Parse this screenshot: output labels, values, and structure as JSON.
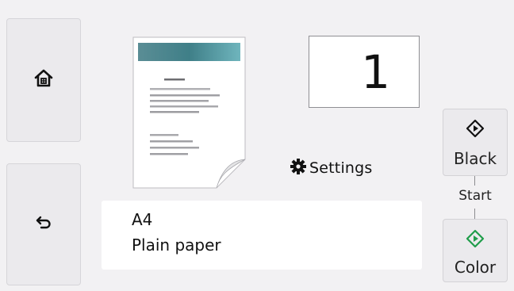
{
  "nav": {
    "home_icon": "home-icon",
    "back_icon": "back-arrow-icon"
  },
  "copies": {
    "value": "1"
  },
  "settings": {
    "icon": "gear-icon",
    "label": "Settings"
  },
  "paper": {
    "size": "A4",
    "type": "Plain paper"
  },
  "start": {
    "caption": "Start",
    "black_label": "Black",
    "color_label": "Color",
    "black_icon_color": "#111111",
    "color_icon_color": "#1f9d4a"
  },
  "colors": {
    "background": "#f2f1f3",
    "button": "#ebeaed",
    "preview_header": "#3f8f97"
  }
}
